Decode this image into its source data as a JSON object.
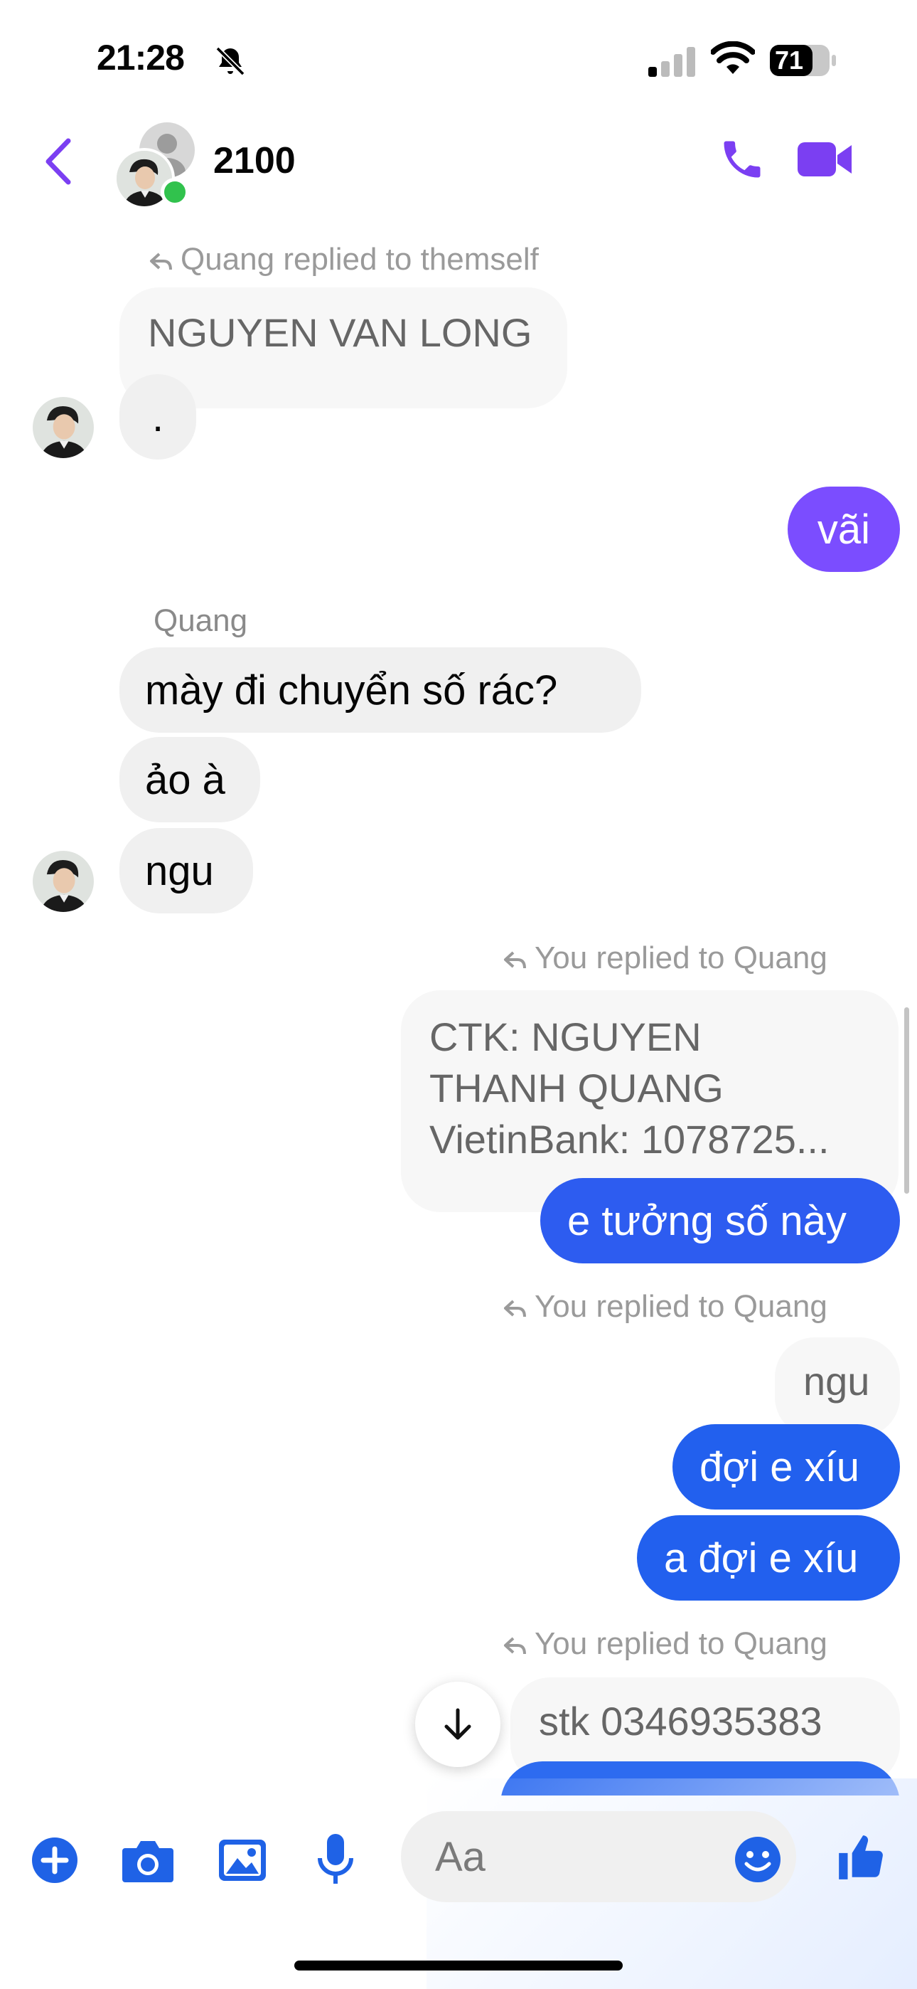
{
  "status_bar": {
    "time": "21:28",
    "battery": "71"
  },
  "header": {
    "title": "2100"
  },
  "messages": {
    "m1_reply_label": "Quang replied to themself",
    "m1_quoted": "NGUYEN VAN LONG",
    "m1_text": ".",
    "m2_text": "vãi",
    "m3_sender": "Quang",
    "m3_text": "mày đi chuyển số rác?",
    "m4_text": "ảo à",
    "m5_text": "ngu",
    "m6_reply_label": "You replied to Quang",
    "m6_quoted_line1": "CTK: NGUYEN",
    "m6_quoted_line2": "THANH QUANG",
    "m6_quoted_line3": "VietinBank: 1078725...",
    "m6_text": "e tưởng số này",
    "m7_reply_label": "You replied to Quang",
    "m7_quoted": "ngu",
    "m7_text": "đợi e xíu",
    "m8_text": "a đợi e xíu",
    "m9_reply_label": "You replied to Quang",
    "m9_quoted": "stk 0346935383"
  },
  "composer": {
    "placeholder": "Aa"
  },
  "colors": {
    "accent": "#7b3ff2",
    "bubble_purple": "#7b4dff",
    "bubble_blue": "#2d5cf0",
    "bubble_blue2": "#2260ee",
    "online": "#31c24d"
  },
  "icons": [
    "bell-slash-icon",
    "signal-icon",
    "wifi-icon",
    "battery-icon",
    "back-icon",
    "phone-icon",
    "video-icon",
    "reply-arrow-icon",
    "arrow-down-icon",
    "plus-icon",
    "camera-icon",
    "gallery-icon",
    "microphone-icon",
    "emoji-icon",
    "thumbs-up-icon"
  ]
}
